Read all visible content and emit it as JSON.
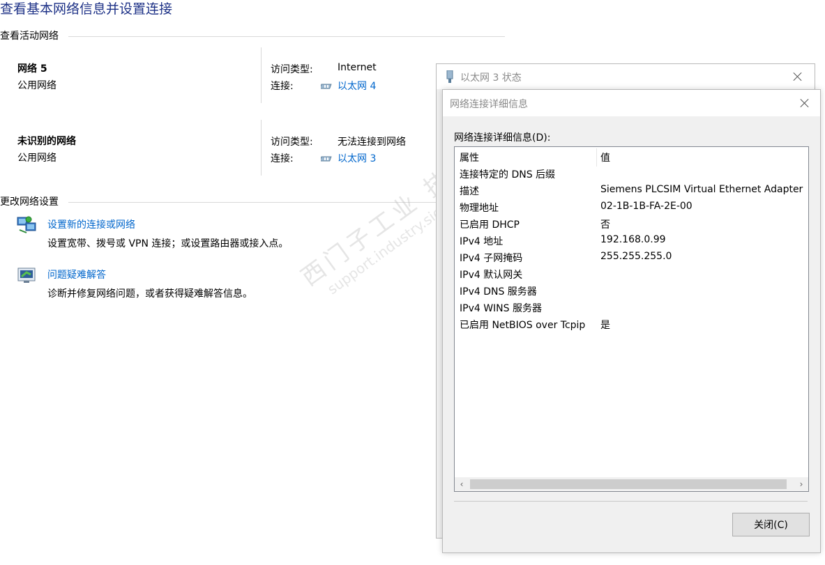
{
  "page": {
    "title": "查看基本网络信息并设置连接",
    "active_networks_header": "查看活动网络",
    "change_settings_header": "更改网络设置"
  },
  "networks": [
    {
      "name": "网络 5",
      "category": "公用网络",
      "access_label": "访问类型:",
      "access_value": "Internet",
      "connection_label": "连接:",
      "connection_link": "以太网 4"
    },
    {
      "name": "未识别的网络",
      "category": "公用网络",
      "access_label": "访问类型:",
      "access_value": "无法连接到网络",
      "connection_label": "连接:",
      "connection_link": "以太网 3"
    }
  ],
  "tasks": [
    {
      "title": "设置新的连接或网络",
      "desc": "设置宽带、拨号或 VPN 连接；或设置路由器或接入点。",
      "icon": "network-setup-icon"
    },
    {
      "title": "问题疑难解答",
      "desc": "诊断并修复网络问题，或者获得疑难解答信息。",
      "icon": "troubleshoot-icon"
    }
  ],
  "status_window": {
    "title": "以太网 3 状态"
  },
  "details_dialog": {
    "title": "网络连接详细信息",
    "list_label": "网络连接详细信息(D):",
    "columns": [
      "属性",
      "值"
    ],
    "rows": [
      {
        "prop": "连接特定的 DNS 后缀",
        "value": ""
      },
      {
        "prop": "描述",
        "value": "Siemens PLCSIM Virtual Ethernet Adapter"
      },
      {
        "prop": "物理地址",
        "value": "02-1B-1B-FA-2E-00"
      },
      {
        "prop": "已启用 DHCP",
        "value": "否"
      },
      {
        "prop": "IPv4 地址",
        "value": "192.168.0.99"
      },
      {
        "prop": "IPv4 子网掩码",
        "value": "255.255.255.0"
      },
      {
        "prop": "IPv4 默认网关",
        "value": ""
      },
      {
        "prop": "IPv4 DNS 服务器",
        "value": ""
      },
      {
        "prop": "IPv4 WINS 服务器",
        "value": ""
      },
      {
        "prop": "已启用 NetBIOS over Tcpip",
        "value": "是"
      }
    ],
    "close_button": "关闭(C)"
  },
  "watermark": {
    "line1": "西门子工业 技术",
    "line2": "support.industry.siemens.com/cs"
  },
  "colors": {
    "title": "#1e3287",
    "link": "#0066cc",
    "dialog_bg": "#f0f0f0"
  }
}
